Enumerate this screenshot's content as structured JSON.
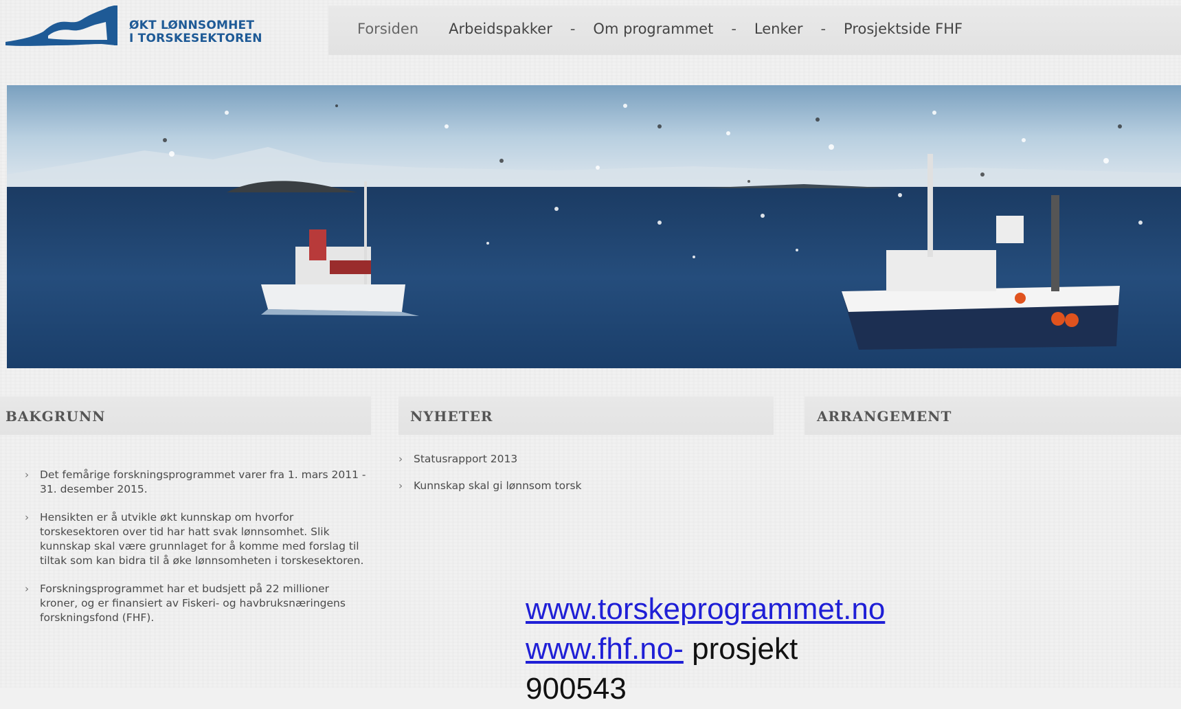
{
  "logo": {
    "line1": "ØKT LØNNSOMHET",
    "line2": "I TORSKESEKTOREN"
  },
  "nav": {
    "items": [
      "Forsiden",
      "Arbeidspakker",
      "Om programmet",
      "Lenker",
      "Prosjektside FHF"
    ],
    "separator": "-"
  },
  "hero": {
    "alt_icon": "fishing-boats-photo"
  },
  "columns": {
    "bakgrunn": {
      "title": "BAKGRUNN",
      "items": [
        "Det femårige forskningsprogrammet varer fra 1. mars 2011 - 31. desember 2015.",
        "Hensikten er å utvikle økt kunnskap om hvorfor torskesektoren over tid har hatt svak lønnsomhet. Slik kunnskap skal være grunnlaget for å komme med forslag til tiltak som kan bidra til å øke lønnsomheten i torskesektoren.",
        "Forskningsprogrammet har et budsjett på 22 millioner kroner, og er finansiert av Fiskeri- og havbruksnæringens forskningsfond (FHF)."
      ]
    },
    "nyheter": {
      "title": "NYHETER",
      "items": [
        "Statusrapport 2013",
        "Kunnskap skal gi lønnsom torsk"
      ]
    },
    "arrangement": {
      "title": "ARRANGEMENT"
    }
  },
  "links": {
    "url1": "www.torskeprogrammet.no",
    "url2": "www.fhf.no-",
    "suffix": " prosjekt",
    "line3": "900543"
  },
  "colors": {
    "logo_blue": "#1e5a96",
    "link_blue": "#1f1fd6"
  }
}
